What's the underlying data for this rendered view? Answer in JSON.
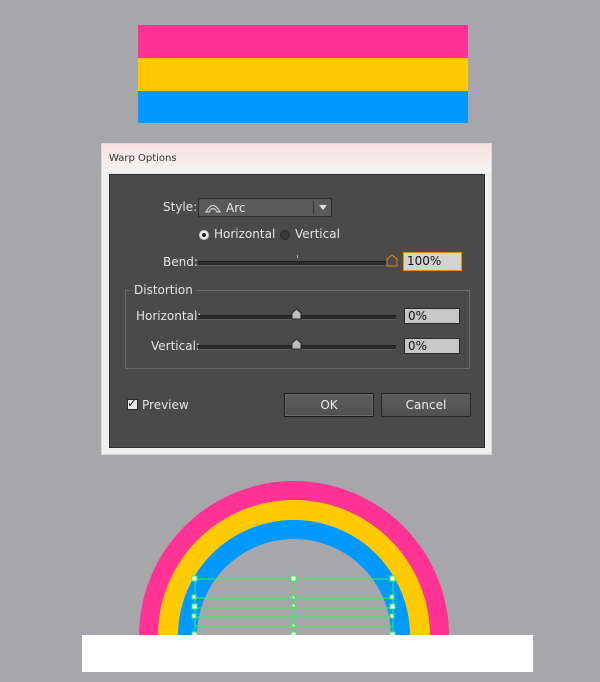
{
  "flag": {
    "colors": [
      "#ff3393",
      "#ffcb00",
      "#0099ff"
    ]
  },
  "dialog": {
    "title": "Warp Options",
    "style": {
      "label": "Style:",
      "selected": "Arc",
      "icon": "arc-style-icon"
    },
    "orientation": {
      "horizontal_label": "Horizontal",
      "vertical_label": "Vertical",
      "selected": "Horizontal"
    },
    "bend": {
      "label": "Bend:",
      "value": "100%",
      "level": 100
    },
    "distortion": {
      "legend": "Distortion",
      "horizontal_label": "Horizontal:",
      "horizontal_value": "0%",
      "horizontal_level": 0,
      "vertical_label": "Vertical:",
      "vertical_value": "0%",
      "vertical_level": 0
    },
    "preview": {
      "label": "Preview",
      "checked": true
    },
    "ok_label": "OK",
    "cancel_label": "Cancel"
  },
  "arch": {
    "colors": [
      "#ff3393",
      "#ffcb00",
      "#0099ff"
    ],
    "selection_color": "#33ee55"
  }
}
